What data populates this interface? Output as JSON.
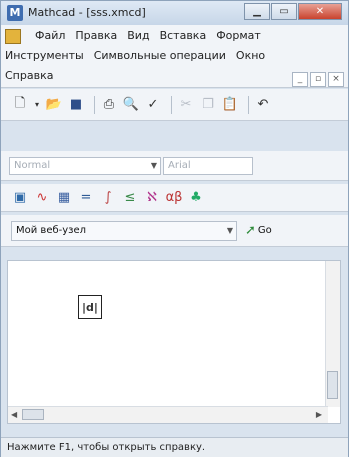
{
  "window": {
    "title": "Mathcad - [sss.xmcd]"
  },
  "menu": {
    "row1": [
      "Файл",
      "Правка",
      "Вид",
      "Вставка",
      "Формат"
    ],
    "row2": [
      "Инструменты",
      "Символьные операции",
      "Окно"
    ],
    "row3": [
      "Справка"
    ]
  },
  "format_toolbar": {
    "style_value": "Normal",
    "font_value": "Arial"
  },
  "web_toolbar": {
    "address_value": "Мой веб-узел",
    "go_label": "Go"
  },
  "statusbar": {
    "text": "Нажмите F1, чтобы открыть справку."
  },
  "icons": {
    "app": "mathcad-logo-icon",
    "document": "document-icon"
  },
  "colors": {
    "close_button": "#c9432e",
    "title_gradient": "#dfe9f5"
  }
}
